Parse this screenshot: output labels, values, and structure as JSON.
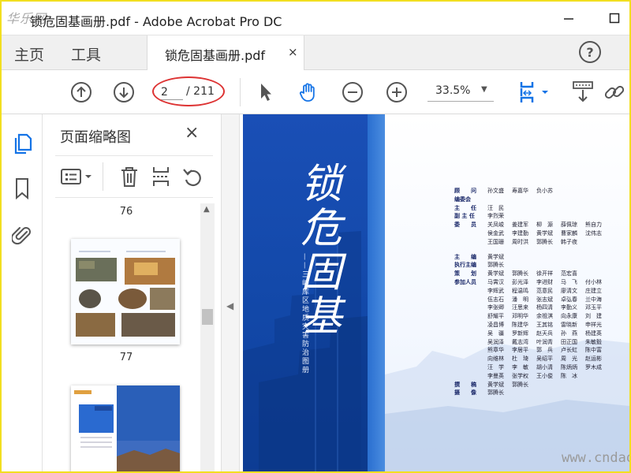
{
  "window": {
    "logo_text": "华乐网",
    "title": "锁危固基画册.pdf - Adobe Acrobat Pro DC"
  },
  "tabs": {
    "home": "主页",
    "tools": "工具",
    "document": "锁危固基画册.pdf",
    "close_glyph": "×",
    "help_glyph": "?"
  },
  "toolbar": {
    "current_page": "2",
    "total_pages": "/ 211",
    "zoom": "33.5%",
    "icons": [
      "arrow-up-circle",
      "arrow-down-circle",
      "select-cursor",
      "hand-tool",
      "zoom-out",
      "zoom-in",
      "page-fit",
      "scroll-mode",
      "link"
    ]
  },
  "sidebar": {
    "panel_title": "页面缩略图",
    "close_glyph": "×",
    "rail_icons": [
      "page-thumbnails",
      "bookmark",
      "attachment"
    ],
    "panel_tools": [
      "options-menu",
      "delete-page",
      "extract-page",
      "rotate-page"
    ],
    "thumbnails": [
      {
        "page": "76"
      },
      {
        "page": "77"
      }
    ]
  },
  "document": {
    "cover_title": "锁危固基",
    "cover_subtitle": "——三峡库区地质灾害防治图册",
    "credits": [
      {
        "role": "顾　　问",
        "names": [
          "孙文盛",
          "寿嘉华",
          "负小苏"
        ]
      },
      {
        "role": "编委会",
        "names": []
      },
      {
        "role": "主　　任",
        "names": [
          "汪　民"
        ]
      },
      {
        "role": "副 主 任",
        "names": [
          "李烈荣"
        ]
      },
      {
        "role": "委　　员",
        "names": [
          "关凤峻",
          "姜建军",
          "柳　源",
          "薛佩琼",
          "熊自力",
          "侯金武",
          "李建勤",
          "黄学斌",
          "曹家麟",
          "沈伟志",
          "王国珊",
          "周时洪",
          "郭腾长",
          "韩子夜"
        ]
      },
      {
        "role": "主　　编",
        "names": [
          "黄学斌"
        ]
      },
      {
        "role": "执行主编",
        "names": [
          "郭腾长"
        ]
      },
      {
        "role": "策　　划",
        "names": [
          "黄学斌",
          "郭腾长",
          "徐开祥",
          "范宏喜"
        ]
      },
      {
        "role": "参加人员",
        "names": [
          "马霄汉",
          "彭光泽",
          "李进财",
          "马　飞",
          "付小林",
          "李辉武",
          "程温鸣",
          "范意民",
          "廖清文",
          "庄建立",
          "伍志石",
          "潘　明",
          "张志斌",
          "卓弘春",
          "兰中海",
          "李张卿",
          "汪思来",
          "杨四清",
          "李勤义",
          "邓玉平",
          "舒耀平",
          "邓明华",
          "余祖淇",
          "向永康",
          "刘　建",
          "凌昌博",
          "陈建华",
          "王其铭",
          "雷晓新",
          "申祥光",
          "吴　疆",
          "罗新辉",
          "赵天兵",
          "孙　燕",
          "杨建英",
          "吴润泽",
          "戴志湾",
          "叶润青",
          "田正国",
          "朱敏毅",
          "熊章华",
          "李居平",
          "郭　兵",
          "卢长虹",
          "陈中富",
          "向维林",
          "杜　琦",
          "吴绍平",
          "周　光",
          "赵运彬",
          "汪　学",
          "李　敏",
          "胡小清",
          "陈炳炳",
          "罗木成",
          "李曼英",
          "张学权",
          "王小俊",
          "陈　冰"
        ]
      },
      {
        "role": "撰　　稿",
        "names": [
          "黄学斌",
          "郭腾长"
        ]
      },
      {
        "role": "摄　　像",
        "names": [
          "郭腾长"
        ]
      }
    ]
  },
  "watermark": "www.cndao.com",
  "colors": {
    "accent_blue": "#1473e6",
    "cover_blue": "#1248a8",
    "highlight_red": "#dd3333"
  }
}
